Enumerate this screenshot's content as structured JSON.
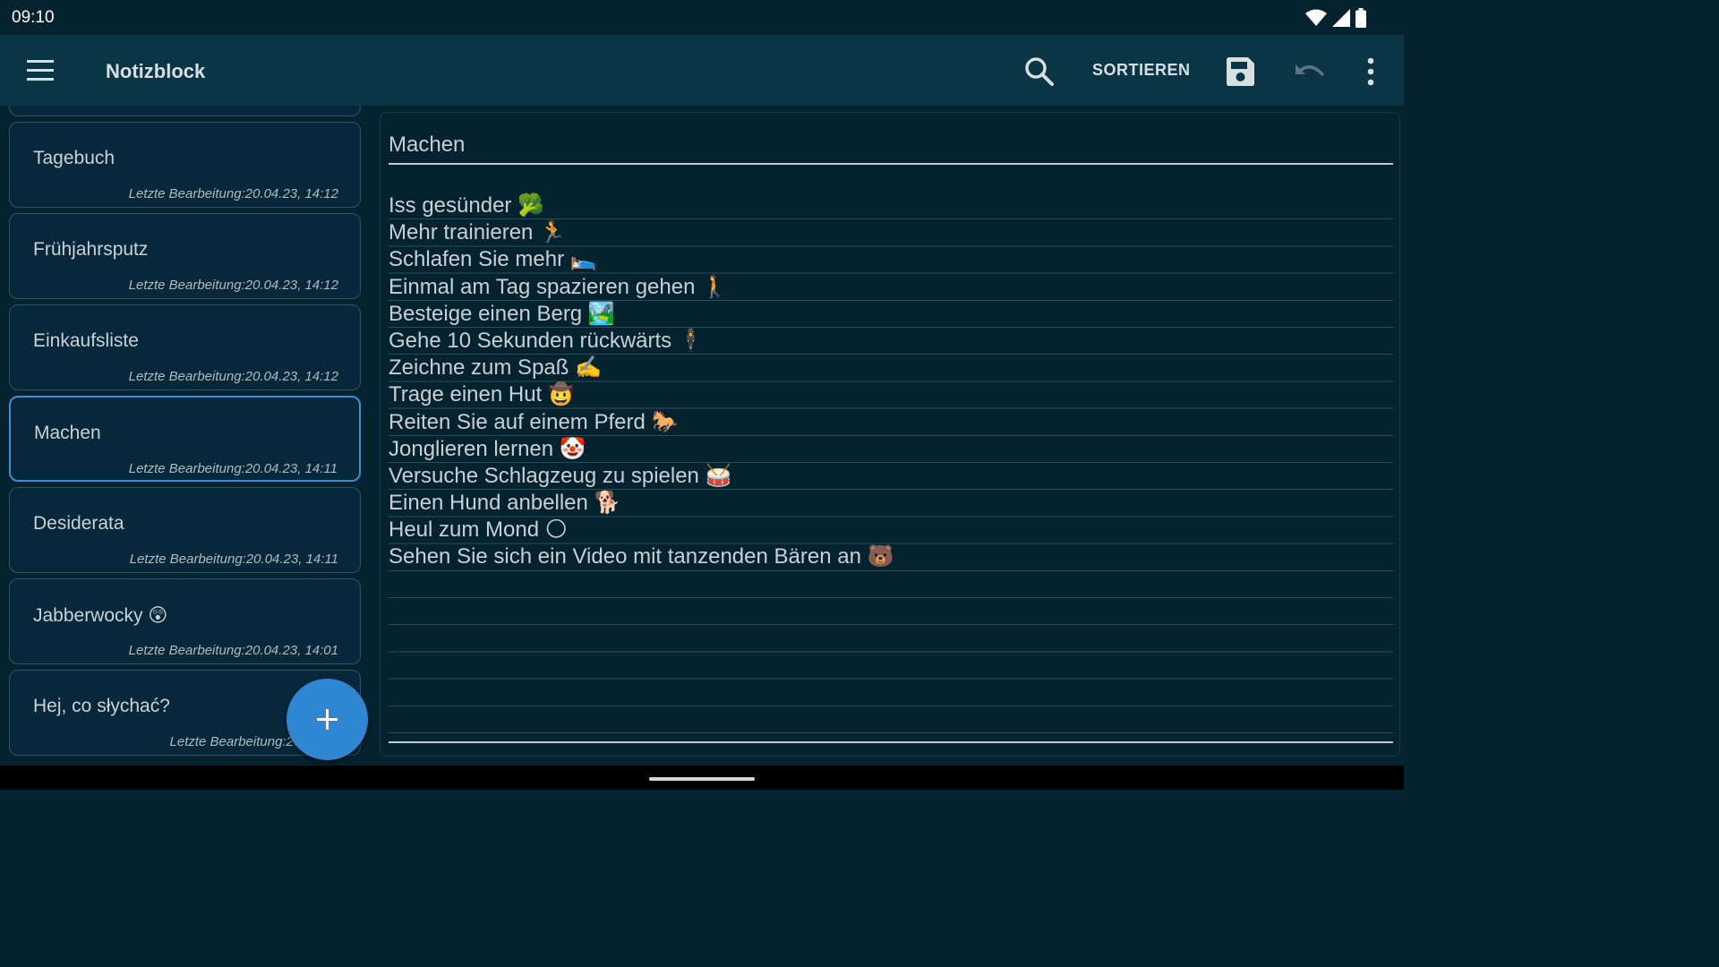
{
  "status_bar": {
    "time": "09:10"
  },
  "app_bar": {
    "title": "Notizblock",
    "sort_label": "SORTIEREN",
    "icons": [
      "menu-icon",
      "search-icon",
      "save-icon",
      "undo-icon",
      "more-vert-icon"
    ]
  },
  "notes": [
    {
      "title": "Tagebuch",
      "date": "Letzte Bearbeitung:20.04.23, 14:12"
    },
    {
      "title": "Frühjahrsputz",
      "date": "Letzte Bearbeitung:20.04.23, 14:12"
    },
    {
      "title": "Einkaufsliste",
      "date": "Letzte Bearbeitung:20.04.23, 14:12"
    },
    {
      "title": "Machen",
      "date": "Letzte Bearbeitung:20.04.23, 14:11"
    },
    {
      "title": "Desiderata",
      "date": "Letzte Bearbeitung:20.04.23, 14:11"
    },
    {
      "title": "Jabberwocky 😲",
      "date": "Letzte Bearbeitung:20.04.23, 14:01"
    },
    {
      "title": "Hej, co słychać?",
      "date": "Letzte Bearbeitung:20.04.23"
    }
  ],
  "selected_note_index": 3,
  "editor": {
    "title": "Machen",
    "lines": [
      "Iss gesünder 🥦",
      "Mehr trainieren 🏃",
      "Schlafen Sie mehr 🛌",
      "Einmal am Tag spazieren gehen 🚶",
      "Besteige einen Berg 🏞️",
      "Gehe 10 Sekunden rückwärts 🕴",
      "Zeichne zum Spaß ✍️",
      "Trage einen Hut 🤠",
      "Reiten Sie auf einem Pferd 🐎",
      "Jonglieren lernen 🤡",
      "Versuche Schlagzeug zu spielen 🥁",
      "Einen Hund anbellen 🐕",
      "Heul zum Mond 🌕",
      "Sehen Sie sich ein Video mit tanzenden Bären an 🐻"
    ]
  },
  "colors": {
    "background": "#05222f",
    "app_bar": "#0a3545",
    "accent": "#2f86d2",
    "selected_border": "#3b8fd9"
  }
}
